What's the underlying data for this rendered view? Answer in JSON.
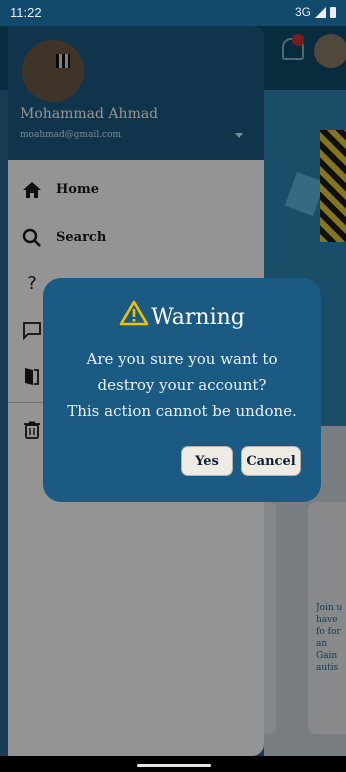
{
  "status_bar": {
    "time": "11:22",
    "network": "3G"
  },
  "background": {
    "notification_badge": "0",
    "card_text": "Join u have fo for an Gain autis"
  },
  "drawer": {
    "user_name": "Mohammad Ahmad",
    "user_email": "moahmad@gmail.com",
    "items": [
      {
        "icon": "home-icon",
        "glyph": "⌂",
        "label": "Home"
      },
      {
        "icon": "search-icon",
        "glyph": "⚲",
        "label": "Search"
      },
      {
        "icon": "help-icon",
        "glyph": "?",
        "label": ""
      },
      {
        "icon": "chat-icon",
        "glyph": "▭",
        "label": ""
      },
      {
        "icon": "logout-icon",
        "glyph": "⇥",
        "label": ""
      },
      {
        "icon": "delete-icon",
        "glyph": "🗑",
        "label": ""
      }
    ]
  },
  "dialog": {
    "title": "Warning",
    "message_line1": "Are you sure you want to",
    "message_line2": "destroy your account?",
    "message_line3": "This action cannot be undone.",
    "yes_label": "Yes",
    "cancel_label": "Cancel",
    "warning_color": "#f2c200"
  }
}
